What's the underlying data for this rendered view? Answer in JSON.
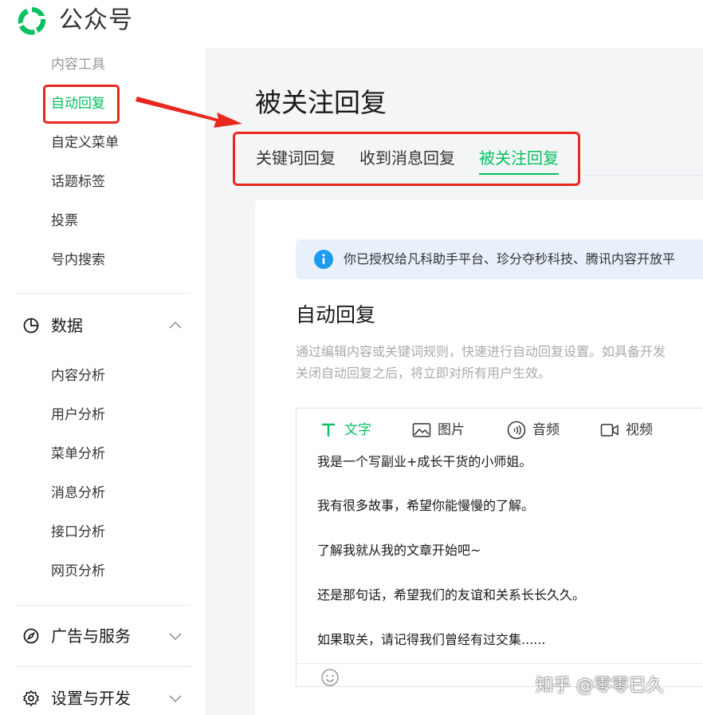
{
  "app": {
    "brand": "公众号"
  },
  "sidebar": {
    "items_top": [
      "内容工具",
      "自动回复",
      "自定义菜单",
      "话题标签",
      "投票",
      "号内搜索"
    ],
    "data_group": {
      "label": "数据",
      "items": [
        "内容分析",
        "用户分析",
        "菜单分析",
        "消息分析",
        "接口分析",
        "网页分析"
      ]
    },
    "ads_group": {
      "label": "广告与服务"
    },
    "settings_group": {
      "label": "设置与开发"
    }
  },
  "main": {
    "title": "被关注回复",
    "tabs": [
      "关键词回复",
      "收到消息回复",
      "被关注回复"
    ],
    "notice": "你已授权给凡科助手平台、珍分夺秒科技、腾讯内容开放平",
    "section_title": "自动回复",
    "desc_lines": [
      "通过编辑内容或关键词规则，快速进行自动回复设置。如具备开发",
      "关闭自动回复之后，将立即对所有用户生效。"
    ],
    "toolbar": [
      "文字",
      "图片",
      "音频",
      "视频"
    ],
    "content_lines": [
      "我是一个写副业+成长干货的小师姐。",
      "我有很多故事，希望你能慢慢的了解。",
      "了解我就从我的文章开始吧~",
      "还是那句话，希望我们的友谊和关系长长久久。",
      "如果取关，请记得我们曾经有过交集......"
    ]
  },
  "watermark": "知乎 @零零已久",
  "colors": {
    "accent": "#07c160",
    "highlight": "#e8281e",
    "info": "#1d9bf0"
  }
}
